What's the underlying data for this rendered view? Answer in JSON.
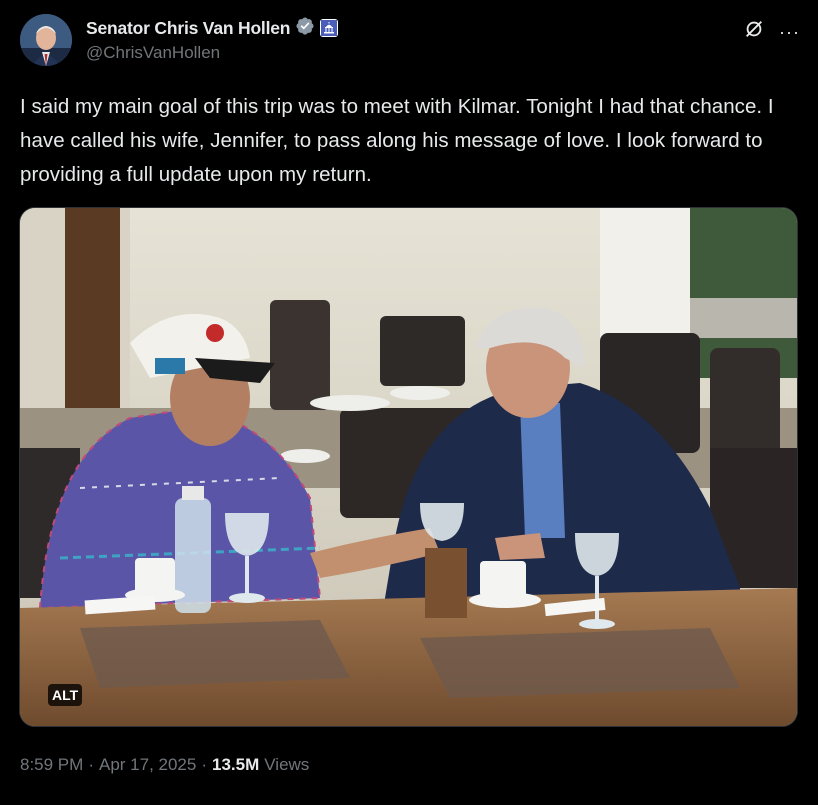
{
  "author": {
    "display_name": "Senator Chris Van Hollen",
    "handle": "@ChrisVanHollen",
    "verified_icon": "verified-badge-icon",
    "affiliation_icon": "capitol-affiliation-icon"
  },
  "actions": {
    "grok_icon": "grok-icon",
    "more_label": "···"
  },
  "tweet": {
    "text": "I said my main goal of this trip was to meet with Kilmar. Tonight I had that chance. I have called his wife, Jennifer, to pass along his message of love. I look forward to providing a full update upon my return."
  },
  "media": {
    "alt_badge": "ALT"
  },
  "meta": {
    "time": "8:59 PM",
    "sep1": "·",
    "date": "Apr 17, 2025",
    "sep2": "·",
    "views_count": "13.5M",
    "views_label": "Views"
  },
  "colors": {
    "background": "#000000",
    "text_primary": "#e7e9ea",
    "text_secondary": "#71767b",
    "verified": "#1d9bf0"
  }
}
